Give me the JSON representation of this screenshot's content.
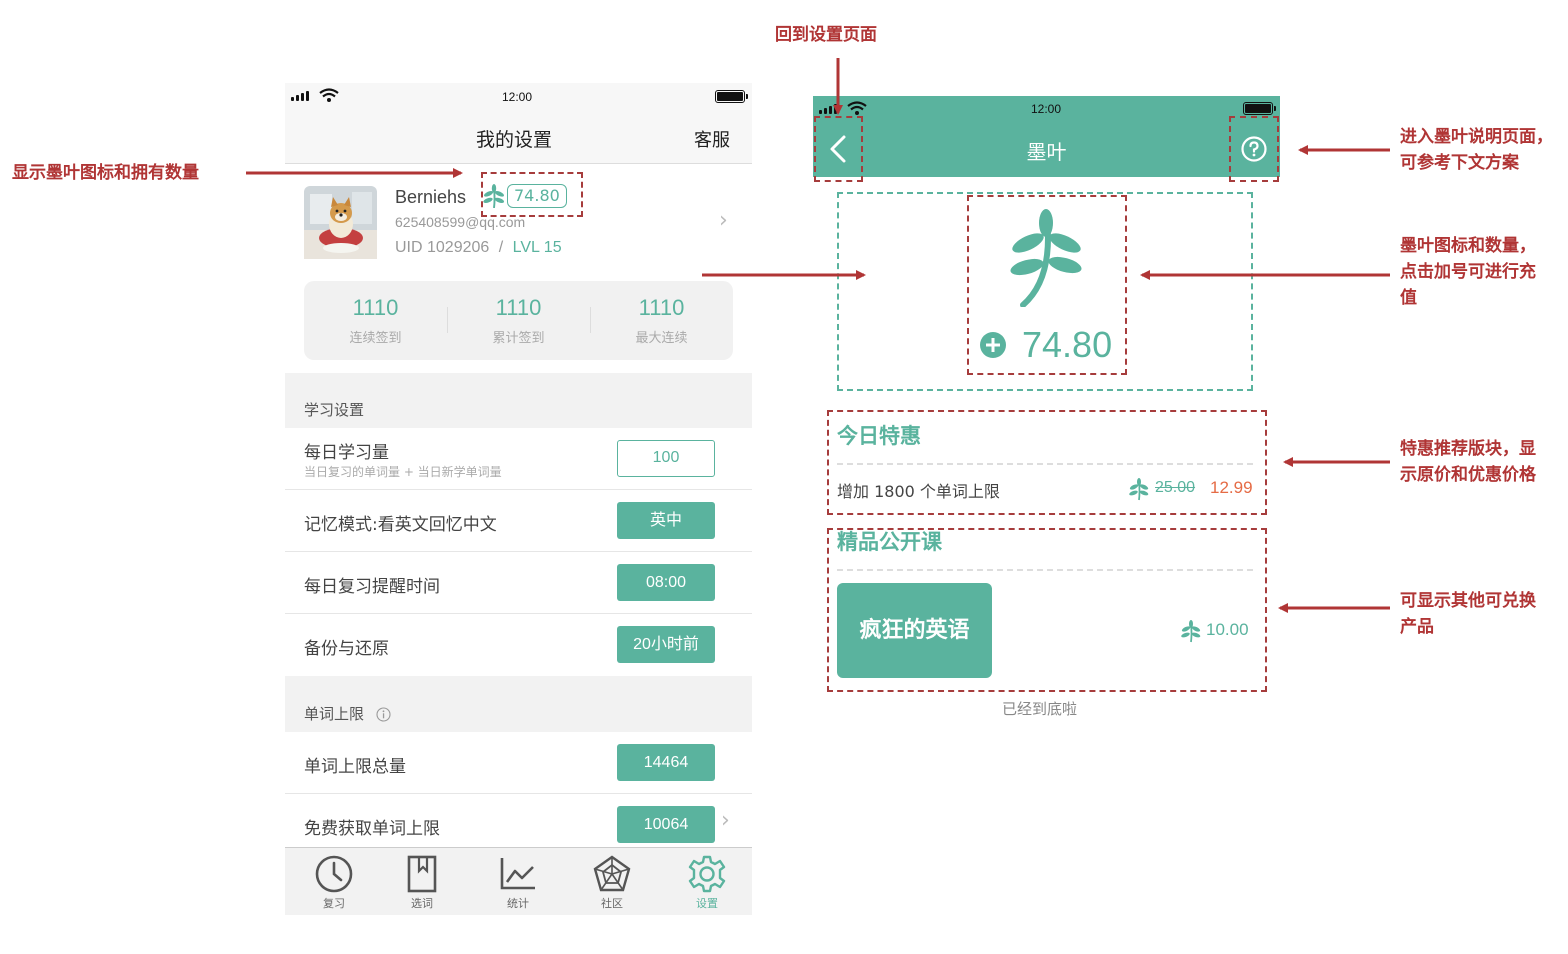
{
  "colors": {
    "accent": "#5ab39e",
    "annotation": "#b03535",
    "price_sale": "#e56b45"
  },
  "left_phone": {
    "status": {
      "time": "12:00"
    },
    "nav": {
      "title": "我的设置",
      "right_action": "客服"
    },
    "profile": {
      "name": "Berniehs",
      "leaf_amount": "74.80",
      "email": "625408599@qq.com",
      "uid": "UID 1029206",
      "separator": "/",
      "level": "LVL 15"
    },
    "stats": [
      {
        "value": "1110",
        "label": "连续签到"
      },
      {
        "value": "1110",
        "label": "累计签到"
      },
      {
        "value": "1110",
        "label": "最大连续"
      }
    ],
    "study_section": {
      "title": "学习设置",
      "rows": [
        {
          "label": "每日学习量",
          "sublabel": "当日复习的单词量 + 当日新学单词量",
          "value": "100"
        },
        {
          "label": "记忆模式:看英文回忆中文",
          "value": "英中"
        },
        {
          "label": "每日复习提醒时间",
          "value": "08:00"
        },
        {
          "label": "备份与还原",
          "value": "20小时前"
        }
      ]
    },
    "limit_section": {
      "title": "单词上限",
      "info_icon": "info-icon",
      "rows": [
        {
          "label": "单词上限总量",
          "value": "14464"
        },
        {
          "label": "免费获取单词上限",
          "value": "10064"
        }
      ]
    },
    "tabs": [
      {
        "label": "复习",
        "icon": "clock-icon"
      },
      {
        "label": "选词",
        "icon": "bookmark-book-icon"
      },
      {
        "label": "统计",
        "icon": "line-chart-icon"
      },
      {
        "label": "社区",
        "icon": "radar-icon"
      },
      {
        "label": "设置",
        "icon": "gear-icon",
        "active": true
      }
    ]
  },
  "right_phone": {
    "status": {
      "time": "12:00"
    },
    "nav": {
      "title": "墨叶"
    },
    "balance": {
      "amount": "74.80"
    },
    "deal": {
      "title": "今日特惠",
      "item": "增加 1800 个单词上限",
      "old_price": "25.00",
      "new_price": "12.99"
    },
    "courses": {
      "title": "精品公开课",
      "item": "疯狂的英语",
      "price": "10.00"
    },
    "footer": "已经到底啦"
  },
  "annotations": {
    "back_to_settings": "回到设置页面",
    "show_leaf": "显示墨叶图标和拥有数量",
    "help_page": [
      "进入墨叶说明页面，",
      "可参考下文方案"
    ],
    "leaf_amount": [
      "墨叶图标和数量，",
      "点击加号可进行充",
      "值"
    ],
    "deal_block": [
      "特惠推荐版块，显",
      "示原价和优惠价格"
    ],
    "other_products": [
      "可显示其他可兑换",
      "产品"
    ]
  }
}
